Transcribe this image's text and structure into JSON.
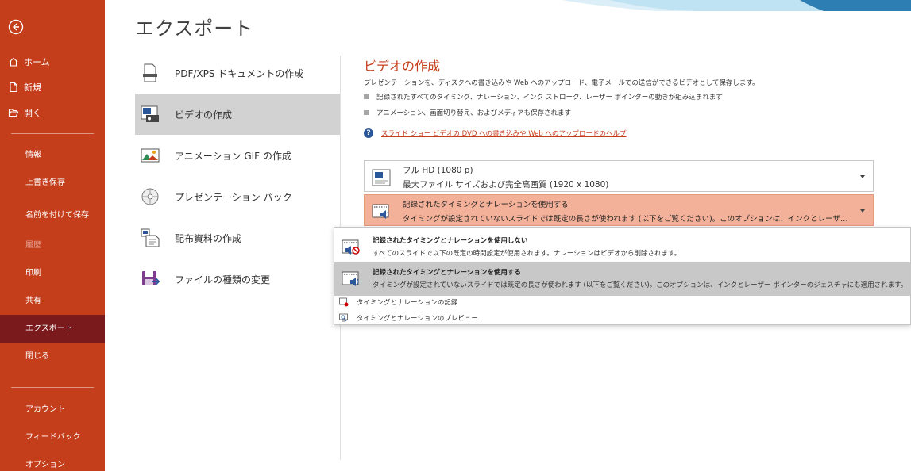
{
  "nav": {
    "top_items": [
      {
        "label": "ホーム",
        "icon": "home-icon"
      },
      {
        "label": "新規",
        "icon": "new-document-icon"
      },
      {
        "label": "開く",
        "icon": "open-folder-icon"
      }
    ],
    "mid_items": [
      {
        "label": "情報"
      },
      {
        "label": "上書き保存"
      },
      {
        "label": "名前を付けて保存"
      },
      {
        "label": "履歴"
      },
      {
        "label": "印刷"
      },
      {
        "label": "共有"
      },
      {
        "label": "エクスポート"
      },
      {
        "label": "閉じる"
      }
    ],
    "bottom_items": [
      {
        "label": "アカウント"
      },
      {
        "label": "フィードバック"
      },
      {
        "label": "オプション"
      }
    ],
    "colors": {
      "background": "#c43e1c",
      "selected": "#7a1a1d"
    }
  },
  "page_title": "エクスポート",
  "export_options": [
    {
      "label": "PDF/XPS ドキュメントの作成",
      "icon": "pdf-document-icon"
    },
    {
      "label": "ビデオの作成",
      "icon": "video-icon"
    },
    {
      "label": "アニメーション GIF の作成",
      "icon": "gif-image-icon"
    },
    {
      "label": "プレゼンテーション パック",
      "icon": "cd-package-icon"
    },
    {
      "label": "配布資料の作成",
      "icon": "handouts-icon"
    },
    {
      "label": "ファイルの種類の変更",
      "icon": "save-as-type-icon"
    }
  ],
  "video": {
    "heading": "ビデオの作成",
    "description": "プレゼンテーションを、ディスクへの書き込みや Web へのアップロード、電子メールでの送信ができるビデオとして保存します。",
    "bullets": [
      "記録されたすべてのタイミング、ナレーション、インク ストローク、レーザー ポインターの動きが組み込まれます",
      "アニメーション、画面切り替え、およびメディアも保存されます"
    ],
    "help_link": "スライド ショー ビデオの DVD への書き込みや Web へのアップロードのヘルプ",
    "quality_dropdown": {
      "title": "フル HD (1080 p)",
      "subtitle": "最大ファイル サイズおよび完全高画質 (1920 x 1080)"
    },
    "timing_dropdown": {
      "title": "記録されたタイミングとナレーションを使用する",
      "subtitle": "タイミングが設定されていないスライドでは既定の長さが使われます (以下をご覧ください)。このオプションは、インクとレーザ…"
    }
  },
  "menu": {
    "options": [
      {
        "title": "記録されたタイミングとナレーションを使用しない",
        "subtitle": "すべてのスライドで以下の既定の時間設定が使用されます。ナレーションはビデオから削除されます。"
      },
      {
        "title": "記録されたタイミングとナレーションを使用する",
        "subtitle": "タイミングが設定されていないスライドでは既定の長さが使われます (以下をご覧ください)。このオプションは、インクとレーザー ポインターのジェスチャにも適用されます。"
      }
    ],
    "actions": [
      {
        "label": "タイミングとナレーションの記録",
        "icon": "record-icon"
      },
      {
        "label": "タイミングとナレーションのプレビュー",
        "icon": "preview-icon"
      }
    ]
  },
  "accent_color": "#c43e1c"
}
